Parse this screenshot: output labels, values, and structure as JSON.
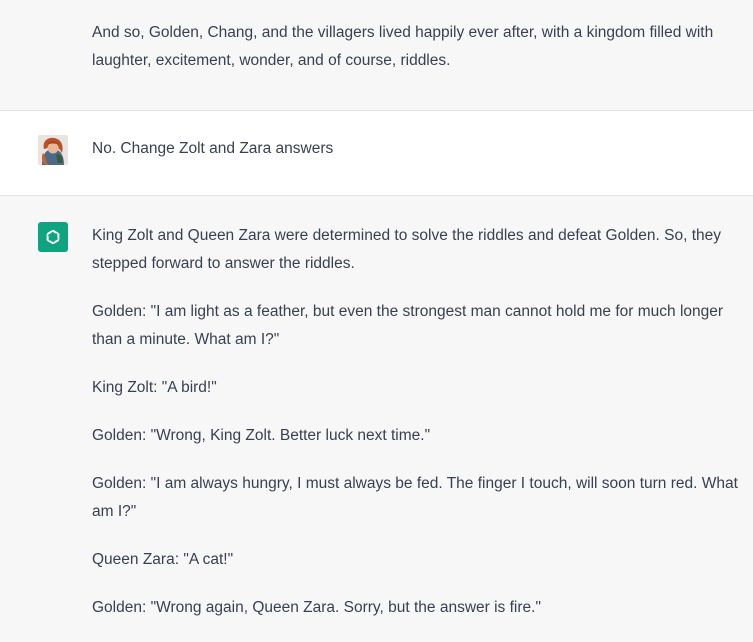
{
  "top_message": {
    "text": "And so, Golden, Chang, and the villagers lived happily ever after, with a kingdom filled with laughter, excitement, wonder, and of course, riddles."
  },
  "user_message": {
    "text": "No. Change Zolt and Zara answers",
    "avatar_icon": "user-avatar-icon"
  },
  "assistant_message": {
    "avatar_icon": "openai-logo-icon",
    "accent_color": "#10a37f",
    "paragraphs": [
      "King Zolt and Queen Zara were determined to solve the riddles and defeat Golden. So, they stepped forward to answer the riddles.",
      "Golden: \"I am light as a feather, but even the strongest man cannot hold me for much longer than a minute. What am I?\"",
      "King Zolt: \"A bird!\"",
      "Golden: \"Wrong, King Zolt. Better luck next time.\"",
      "Golden: \"I am always hungry, I must always be fed. The finger I touch, will soon turn red. What am I?\"",
      "Queen Zara: \"A cat!\"",
      "Golden: \"Wrong again, Queen Zara. Sorry, but the answer is fire.\""
    ]
  }
}
